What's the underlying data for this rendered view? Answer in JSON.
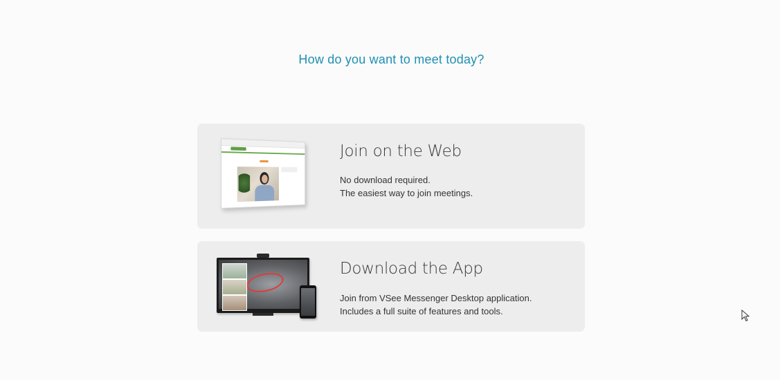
{
  "heading": "How do you want to meet today?",
  "options": [
    {
      "title": "Join on the Web",
      "desc": [
        "No download required.",
        "The easiest way to join meetings."
      ],
      "icon": "web-browser-video-call-illustration"
    },
    {
      "title": "Download the App",
      "desc": [
        "Join from VSee Messenger Desktop application.",
        "Includes a full suite of features and tools."
      ],
      "icon": "desktop-and-phone-app-illustration"
    }
  ],
  "colors": {
    "heading": "#1e8fb3",
    "card_bg": "#ededed",
    "page_bg": "#fbfbfb"
  }
}
